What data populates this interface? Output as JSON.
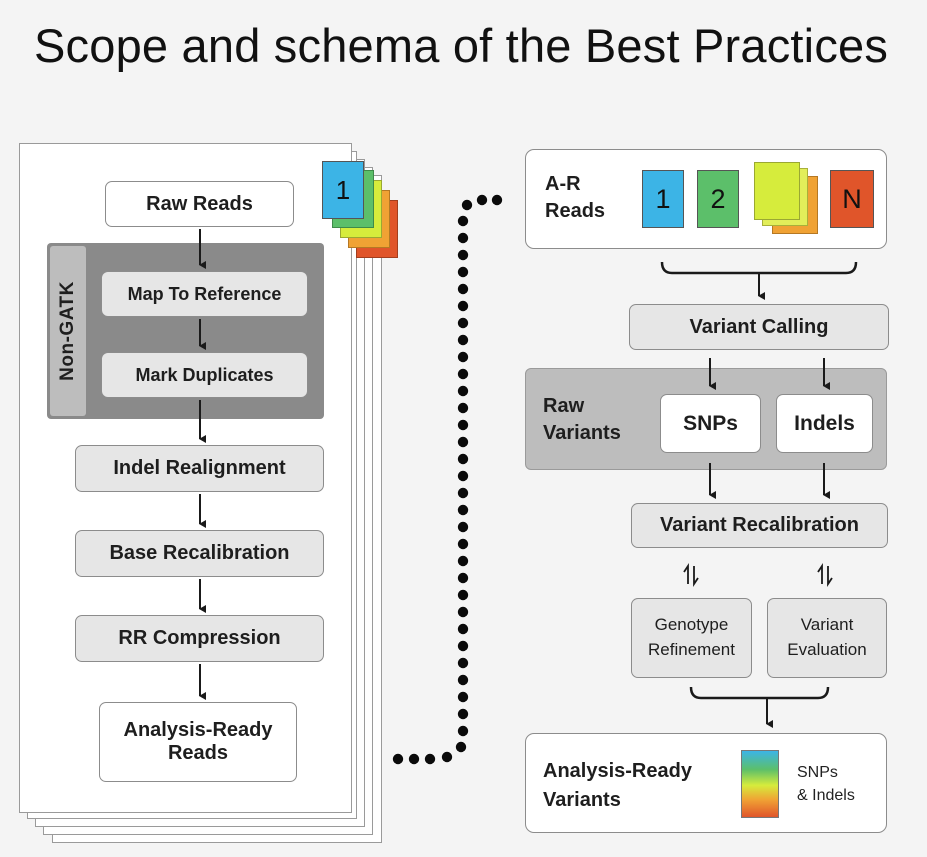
{
  "title": "Scope and schema of the Best Practices",
  "left": {
    "raw_reads": "Raw Reads",
    "non_gatk": "Non-GATK",
    "map_to_reference": "Map To Reference",
    "mark_duplicates": "Mark Duplicates",
    "indel_realignment": "Indel Realignment",
    "base_recalibration": "Base Recalibration",
    "rr_compression": "RR Compression",
    "analysis_ready_reads_1": "Analysis-Ready",
    "analysis_ready_reads_2": "Reads",
    "tab_number": "1"
  },
  "right": {
    "ar_reads_1": "A-R",
    "ar_reads_2": "Reads",
    "sample_1": "1",
    "sample_2": "2",
    "sample_n": "N",
    "variant_calling": "Variant Calling",
    "raw_variants_1": "Raw",
    "raw_variants_2": "Variants",
    "snps": "SNPs",
    "indels": "Indels",
    "variant_recalibration": "Variant Recalibration",
    "genotype_refinement_1": "Genotype",
    "genotype_refinement_2": "Refinement",
    "variant_evaluation_1": "Variant",
    "variant_evaluation_2": "Evaluation",
    "analysis_ready_variants_1": "Analysis-Ready",
    "analysis_ready_variants_2": "Variants",
    "snps_indels_1": "SNPs",
    "snps_indels_2": "& Indels"
  },
  "colors": {
    "blue": "#3cb4e6",
    "green": "#5cbf6a",
    "yellow": "#d6ec3c",
    "orange": "#f0a234",
    "red": "#e0552a",
    "panel_dark": "#8a8a8a",
    "panel_light": "#bdbdbd"
  }
}
